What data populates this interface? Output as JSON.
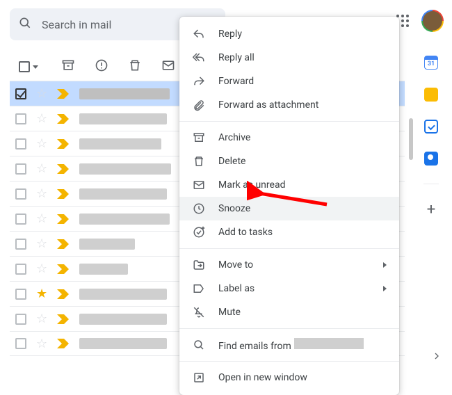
{
  "search": {
    "placeholder": "Search in mail"
  },
  "toolbar": {
    "select_all": "select-all",
    "archive": "archive",
    "spam": "report-spam",
    "delete": "delete",
    "mail": "mark-as-unread"
  },
  "rows": [
    {
      "selected": true,
      "starred": false,
      "sender_width": 130
    },
    {
      "selected": false,
      "starred": false,
      "sender_width": 126
    },
    {
      "selected": false,
      "starred": false,
      "sender_width": 118
    },
    {
      "selected": false,
      "starred": false,
      "sender_width": 132
    },
    {
      "selected": false,
      "starred": false,
      "sender_width": 126
    },
    {
      "selected": false,
      "starred": false,
      "sender_width": 130
    },
    {
      "selected": false,
      "starred": false,
      "sender_width": 80
    },
    {
      "selected": false,
      "starred": false,
      "sender_width": 70
    },
    {
      "selected": false,
      "starred": true,
      "sender_width": 126
    },
    {
      "selected": false,
      "starred": false,
      "sender_width": 126
    },
    {
      "selected": false,
      "starred": false,
      "sender_width": 126
    }
  ],
  "menu": {
    "groups": [
      [
        {
          "key": "reply",
          "label": "Reply"
        },
        {
          "key": "reply-all",
          "label": "Reply all"
        },
        {
          "key": "forward",
          "label": "Forward"
        },
        {
          "key": "fwd-attach",
          "label": "Forward as attachment"
        }
      ],
      [
        {
          "key": "archive",
          "label": "Archive"
        },
        {
          "key": "delete",
          "label": "Delete"
        },
        {
          "key": "mark-unread",
          "label": "Mark as unread"
        },
        {
          "key": "snooze",
          "label": "Snooze",
          "hover": true
        },
        {
          "key": "add-tasks",
          "label": "Add to tasks"
        }
      ],
      [
        {
          "key": "move-to",
          "label": "Move to",
          "submenu": true
        },
        {
          "key": "label-as",
          "label": "Label as",
          "submenu": true
        },
        {
          "key": "mute",
          "label": "Mute"
        }
      ],
      [
        {
          "key": "find-from",
          "label": "Find emails from",
          "redacted": true
        }
      ],
      [
        {
          "key": "open-new",
          "label": "Open in new window"
        }
      ]
    ]
  },
  "sidebar": {
    "items": [
      "calendar",
      "keep",
      "tasks",
      "contacts",
      "get-addons"
    ]
  },
  "annotation": {
    "target": "snooze"
  }
}
